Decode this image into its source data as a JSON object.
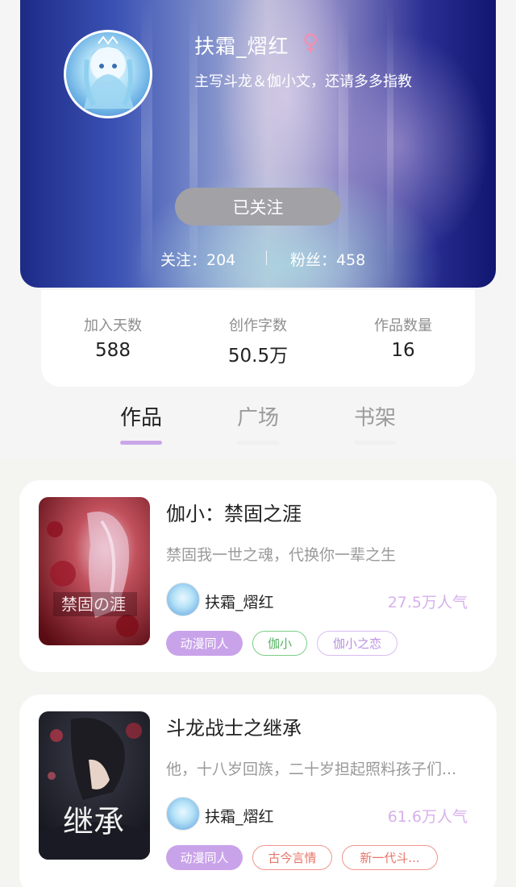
{
  "profile": {
    "username": "扶霜_熠红",
    "gender_icon": "female-symbol-icon",
    "gender_glyph": "♀",
    "bio": "主写斗龙＆伽小文，还请多多指教",
    "follow_button_label": "已关注",
    "following_text": "关注：204",
    "fans_text": "粉丝：458"
  },
  "stats": [
    {
      "label": "加入天数",
      "value": "588"
    },
    {
      "label": "创作字数",
      "value": "50.5万"
    },
    {
      "label": "作品数量",
      "value": "16"
    }
  ],
  "tabs": [
    {
      "label": "作品",
      "active": true
    },
    {
      "label": "广场",
      "active": false
    },
    {
      "label": "书架",
      "active": false
    }
  ],
  "works": [
    {
      "title": "伽小：禁固之涯",
      "description": "禁固我一世之魂，代换你一辈之生",
      "author": "扶霜_熠红",
      "popularity": "27.5万人气",
      "cover_text": "禁固の涯",
      "tags": [
        "动漫同人",
        "伽小",
        "伽小之恋"
      ]
    },
    {
      "title": "斗龙战士之继承",
      "description": "他，十八岁回族，二十岁担起照料孩子们...",
      "author": "扶霜_熠红",
      "popularity": "61.6万人气",
      "cover_text": "继承",
      "tags": [
        "动漫同人",
        "古今言情",
        "新一代斗..."
      ]
    }
  ],
  "colors": {
    "accent": "#c9a6e8",
    "popularity": "#d7b0ec",
    "follow_button": "#a1a1a6"
  }
}
